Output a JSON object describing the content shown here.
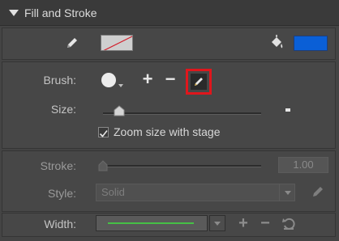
{
  "header": {
    "title": "Fill and Stroke"
  },
  "colors": {
    "fill": "#0a5fd6",
    "stroke_swatch": "#cfcfcf",
    "highlight": "#e0161c",
    "width_line": "#46c046"
  },
  "brush": {
    "label": "Brush:",
    "add_label": "+",
    "remove_label": "−"
  },
  "size": {
    "label": "Size:",
    "value": 0.1
  },
  "zoom": {
    "label": "Zoom size with stage",
    "checked": true
  },
  "stroke": {
    "label": "Stroke:",
    "value": "1.00"
  },
  "style": {
    "label": "Style:",
    "value": "Solid"
  },
  "width": {
    "label": "Width:",
    "add_label": "+",
    "remove_label": "−"
  }
}
